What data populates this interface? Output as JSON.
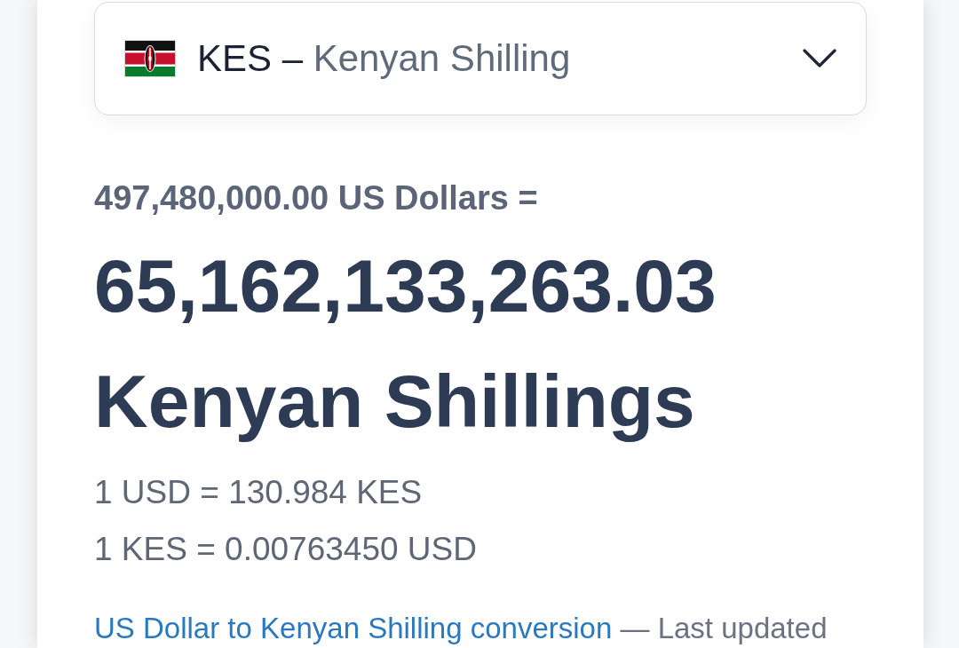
{
  "currency_select": {
    "code": "KES",
    "separator": "–",
    "name": "Kenyan Shilling"
  },
  "conversion": {
    "from_amount": "497,480,000.00 US Dollars =",
    "result": "65,162,133,263.03 Kenyan Shillings",
    "rates": [
      "1 USD = 130.984 KES",
      "1 KES = 0.00763450 USD"
    ]
  },
  "footer": {
    "link": "US Dollar to Kenyan Shilling conversion",
    "text": "— Last updated"
  }
}
